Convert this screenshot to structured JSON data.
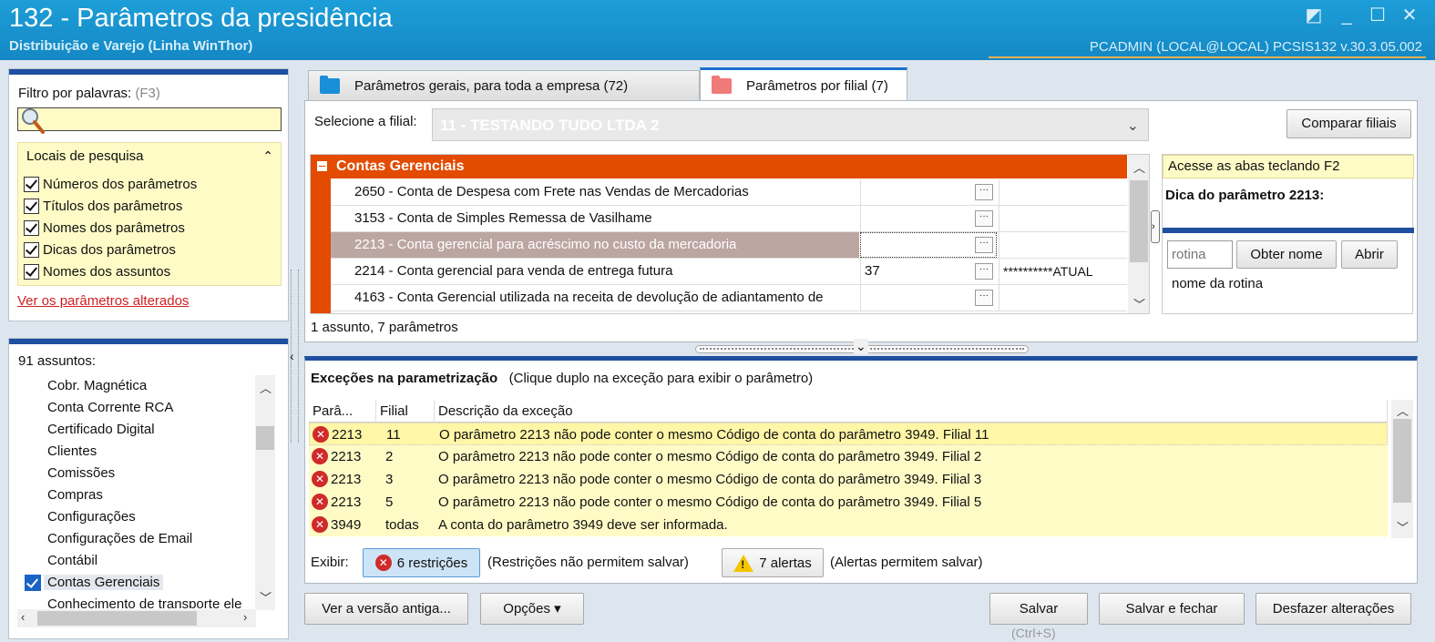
{
  "window": {
    "title": "132 - Parâmetros da presidência",
    "subtitle": "Distribuição e Varejo (Linha WinThor)",
    "user_info": "PCADMIN (LOCAL@LOCAL)   PCSIS132  v.30.3.05.002",
    "controls": {
      "restore": "◩",
      "minimize": "_",
      "maximize": "☐",
      "close": "✕"
    }
  },
  "filter": {
    "label": "Filtro por palavras:",
    "hint": "(F3)",
    "search_value": "",
    "locations_title": "Locais de pesquisa",
    "locations_toggle": "⌃",
    "options": [
      {
        "label": "Números dos parâmetros",
        "checked": true
      },
      {
        "label": "Títulos dos parâmetros",
        "checked": true
      },
      {
        "label": "Nomes dos parâmetros",
        "checked": true
      },
      {
        "label": "Dicas dos parâmetros",
        "checked": true
      },
      {
        "label": "Nomes dos assuntos",
        "checked": true
      }
    ],
    "changed_link": "Ver os parâmetros alterados"
  },
  "subjects": {
    "count_label": "91 assuntos:",
    "items": [
      {
        "label": "Cobr. Magnética"
      },
      {
        "label": "Conta Corrente RCA"
      },
      {
        "label": "Certificado Digital"
      },
      {
        "label": "Clientes"
      },
      {
        "label": "Comissões"
      },
      {
        "label": "Compras"
      },
      {
        "label": "Configurações"
      },
      {
        "label": "Configurações de Email"
      },
      {
        "label": "Contábil"
      },
      {
        "label": "Contas Gerenciais",
        "checked": true
      },
      {
        "label": "Conhecimento de transporte ele"
      }
    ]
  },
  "tabs": [
    {
      "label": "Parâmetros gerais, para toda a empresa  (72)",
      "folder_color": "#1a8fd8"
    },
    {
      "label": "Parâmetros por filial  (7)",
      "folder_color": "#f07a78"
    }
  ],
  "filial": {
    "label": "Selecione a filial:",
    "value": "11 - TESTANDO TUDO LTDA 2",
    "compare_button": "Comparar filiais"
  },
  "grid": {
    "group_title": "Contas Gerenciais",
    "rows": [
      {
        "name": "2650 - Conta de Despesa com Frete nas Vendas de Mercadorias",
        "value": "",
        "extra": ""
      },
      {
        "name": "3153 - Conta de Simples Remessa de Vasilhame",
        "value": "",
        "extra": ""
      },
      {
        "name": "2213 - Conta gerencial para acréscimo no custo da mercadoria",
        "value": "",
        "extra": "",
        "selected": true
      },
      {
        "name": "2214 - Conta gerencial para venda de entrega futura",
        "value": "37",
        "extra": "**********ATUAL"
      },
      {
        "name": "4163 - Conta Gerencial utilizada na receita de devolução de adiantamento de",
        "value": "",
        "extra": ""
      }
    ],
    "dots_label": "···",
    "status": "1 assunto, 7 parâmetros"
  },
  "tips": {
    "f2_hint": "Acesse as abas teclando F2",
    "title": "Dica do parâmetro 2213:",
    "rotina_placeholder": "rotina",
    "obter_button": "Obter nome",
    "abrir_button": "Abrir",
    "rotina_caption": "nome da rotina"
  },
  "exceptions": {
    "title": "Exceções na parametrização",
    "subtitle": "(Clique duplo na exceção para exibir o parâmetro)",
    "headers": [
      "Parâ...",
      "Filial",
      "Descrição da exceção"
    ],
    "rows": [
      {
        "param": "2213",
        "filial": "11",
        "desc": "O parâmetro 2213 não pode conter o mesmo Código de conta do parâmetro 3949. Filial 11"
      },
      {
        "param": "2213",
        "filial": "2",
        "desc": "O parâmetro 2213 não pode conter o mesmo Código de conta do parâmetro 3949. Filial 2"
      },
      {
        "param": "2213",
        "filial": "3",
        "desc": "O parâmetro 2213 não pode conter o mesmo Código de conta do parâmetro 3949. Filial 3"
      },
      {
        "param": "2213",
        "filial": "5",
        "desc": "O parâmetro 2213 não pode conter o mesmo Código de conta do parâmetro 3949. Filial 5"
      },
      {
        "param": "3949",
        "filial": "todas",
        "desc": "A conta do parâmetro 3949 deve ser informada."
      }
    ],
    "show_label": "Exibir:",
    "restrictions_button": "6 restrições",
    "restrictions_note": "(Restrições não permitem salvar)",
    "alerts_button": "7 alertas",
    "alerts_note": "(Alertas permitem salvar)"
  },
  "footer": {
    "old_version": "Ver a versão antiga...",
    "options": "Opções ▾",
    "save": "Salvar",
    "save_shortcut": "(Ctrl+S)",
    "save_close": "Salvar e fechar",
    "undo": "Desfazer alterações"
  },
  "colors": {
    "titlebar": "#1a93d1",
    "accent_orange": "#e24b00",
    "highlight_yellow": "#fffbc6",
    "panel_bar": "#1f4fa0",
    "error_red": "#d02a2a"
  }
}
